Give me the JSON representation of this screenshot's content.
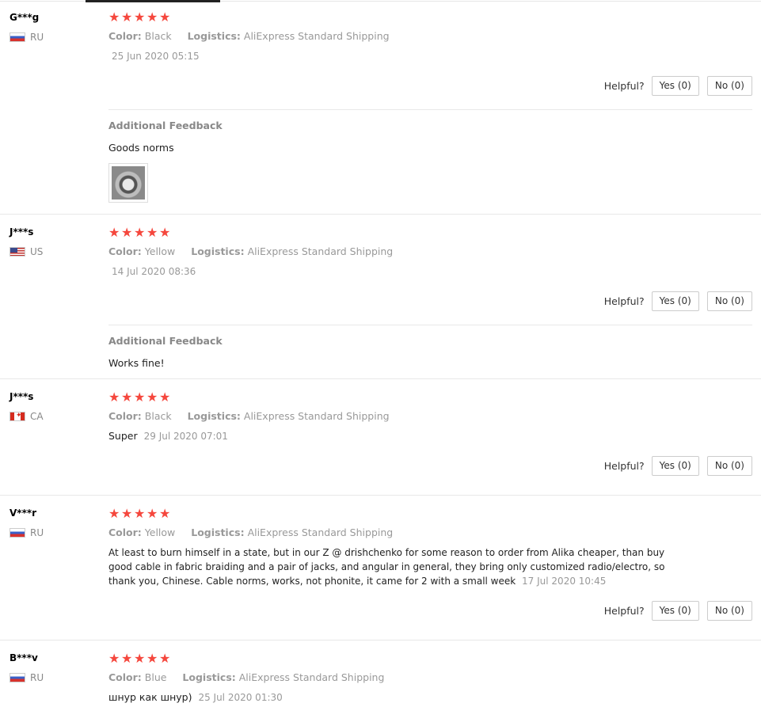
{
  "star_icon": "★",
  "helpful_label": "Helpful?",
  "yes_label": "Yes (0)",
  "no_label": "No (0)",
  "color_key": "Color:",
  "logistics_key": "Logistics:",
  "additional_feedback_title": "Additional Feedback",
  "reviews": [
    {
      "user": "G***g",
      "country": "RU",
      "flag": "ru",
      "color": "Black",
      "logistics": "AliExpress Standard Shipping",
      "text": "",
      "date": "25 Jun 2020 05:15",
      "additional_feedback": "Goods norms",
      "has_photo": true
    },
    {
      "user": "J***s",
      "country": "US",
      "flag": "us",
      "color": "Yellow",
      "logistics": "AliExpress Standard Shipping",
      "text": "",
      "date": "14 Jul 2020 08:36",
      "additional_feedback": "Works fine!",
      "has_photo": false
    },
    {
      "user": "J***s",
      "country": "CA",
      "flag": "ca",
      "color": "Black",
      "logistics": "AliExpress Standard Shipping",
      "text": "Super",
      "date": "29 Jul 2020 07:01"
    },
    {
      "user": "V***r",
      "country": "RU",
      "flag": "ru",
      "color": "Yellow",
      "logistics": "AliExpress Standard Shipping",
      "text": "At least to burn himself in a state, but in our Z @ drishchenko for some reason to order from Alika cheaper, than buy good cable in fabric braiding and a pair of jacks, and angular in general, they bring only customized radio/electro, so thank you, Chinese. Cable norms, works, not phonite, it came for 2 with a small week",
      "date": "17 Jul 2020 10:45"
    },
    {
      "user": "B***v",
      "country": "RU",
      "flag": "ru",
      "color": "Blue",
      "logistics": "AliExpress Standard Shipping",
      "text": "шнур как шнур)",
      "date": "25 Jul 2020 01:30"
    }
  ]
}
